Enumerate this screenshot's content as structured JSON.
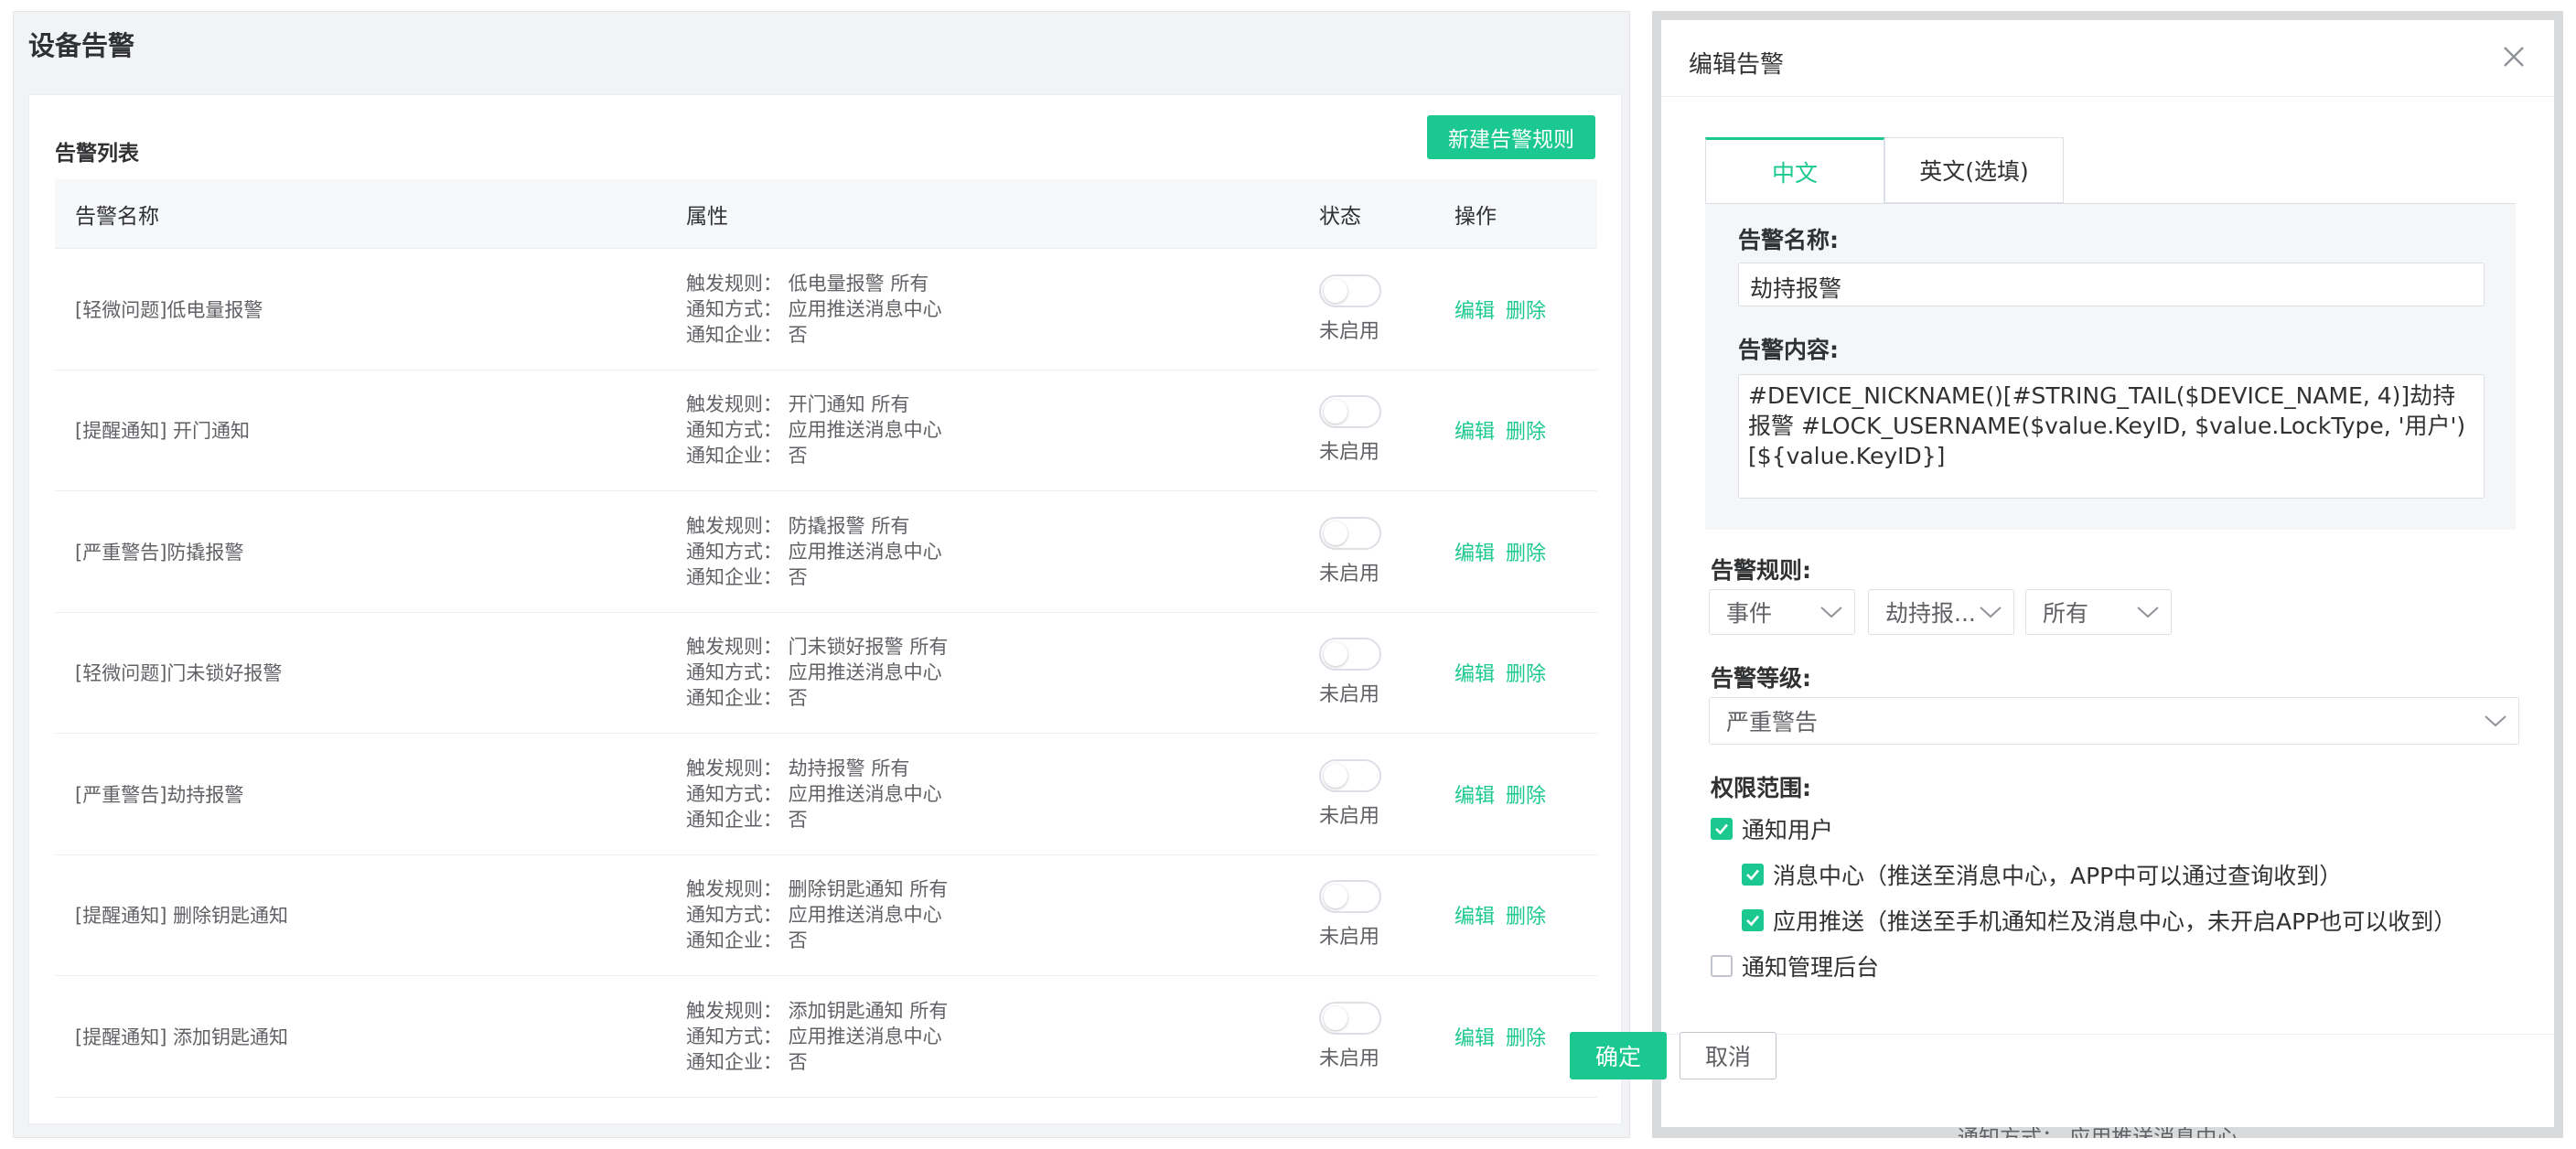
{
  "page": {
    "title": "设备告警"
  },
  "card": {
    "title": "告警列表",
    "new_button": "新建告警规则"
  },
  "table": {
    "headers": {
      "name": "告警名称",
      "attr": "属性",
      "state": "状态",
      "op": "操作"
    },
    "rows": [
      {
        "name": "[轻微问题]低电量报警",
        "trigger": "触发规则： 低电量报警  所有",
        "notify": "通知方式： 应用推送消息中心",
        "enterprise": "通知企业： 否",
        "state": "未启用",
        "edit": "编辑",
        "delete": "删除"
      },
      {
        "name": "[提醒通知] 开门通知",
        "trigger": "触发规则： 开门通知  所有",
        "notify": "通知方式： 应用推送消息中心",
        "enterprise": "通知企业： 否",
        "state": "未启用",
        "edit": "编辑",
        "delete": "删除"
      },
      {
        "name": "[严重警告]防撬报警",
        "trigger": "触发规则： 防撬报警  所有",
        "notify": "通知方式： 应用推送消息中心",
        "enterprise": "通知企业： 否",
        "state": "未启用",
        "edit": "编辑",
        "delete": "删除"
      },
      {
        "name": "[轻微问题]门未锁好报警",
        "trigger": "触发规则： 门未锁好报警  所有",
        "notify": "通知方式： 应用推送消息中心",
        "enterprise": "通知企业： 否",
        "state": "未启用",
        "edit": "编辑",
        "delete": "删除"
      },
      {
        "name": "[严重警告]劫持报警",
        "trigger": "触发规则： 劫持报警  所有",
        "notify": "通知方式： 应用推送消息中心",
        "enterprise": "通知企业： 否",
        "state": "未启用",
        "edit": "编辑",
        "delete": "删除"
      },
      {
        "name": "[提醒通知] 删除钥匙通知",
        "trigger": "触发规则： 删除钥匙通知  所有",
        "notify": "通知方式： 应用推送消息中心",
        "enterprise": "通知企业： 否",
        "state": "未启用",
        "edit": "编辑",
        "delete": "删除"
      },
      {
        "name": "[提醒通知] 添加钥匙通知",
        "trigger": "触发规则： 添加钥匙通知  所有",
        "notify": "通知方式： 应用推送消息中心",
        "enterprise": "通知企业： 否",
        "state": "未启用",
        "edit": "编辑",
        "delete": "删除"
      }
    ]
  },
  "dialog": {
    "title": "编辑告警",
    "tabs": [
      "中文",
      "英文(选填)"
    ],
    "name_label": "告警名称:",
    "name_value": "劫持报警",
    "content_label": "告警内容:",
    "content_value": "#DEVICE_NICKNAME()[#STRING_TAIL($DEVICE_NAME, 4)]劫持报警 #LOCK_USERNAME($value.KeyID, $value.LockType, '用户')[${value.KeyID}]",
    "rule_label": "告警规则:",
    "rule_selects": [
      "事件",
      "劫持报...",
      "所有"
    ],
    "level_label": "告警等级:",
    "level_value": "严重警告",
    "scope_label": "权限范围:",
    "checks": {
      "notify_user": "通知用户",
      "message_center": "消息中心（推送至消息中心，APP中可以通过查询收到）",
      "app_push": "应用推送（推送至手机通知栏及消息中心，未开启APP也可以收到）",
      "notify_admin": "通知管理后台"
    },
    "ok": "确定",
    "cancel": "取消",
    "under_text": "通知方式： 应用推送消息中心"
  },
  "colors": {
    "accent": "#1bc990"
  },
  "icons": {
    "close": "close-icon",
    "chevron": "chevron-down-icon",
    "check": "check-icon"
  }
}
